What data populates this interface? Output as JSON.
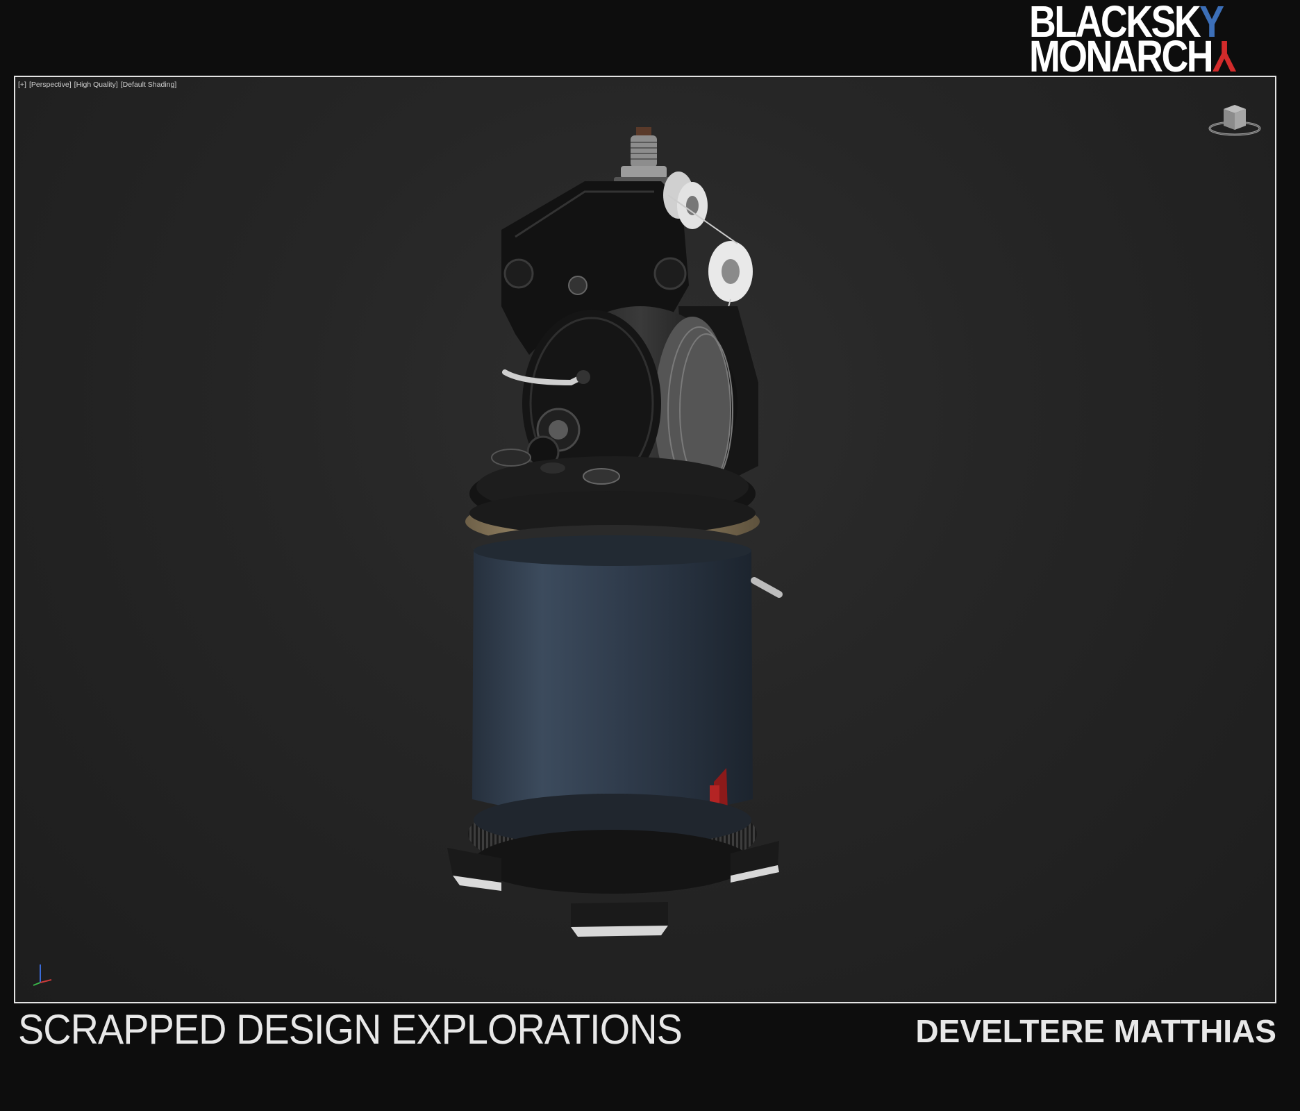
{
  "brand": {
    "line1_main": "BLACKSK",
    "line1_accent": "Y",
    "line2_main": "MONARCH",
    "line2_accent": "Y",
    "accent_blue": "#3c6fb8",
    "accent_red": "#d22b2b"
  },
  "viewport": {
    "label_plus": "[+]",
    "label_view": "[Perspective]",
    "label_quality": "[High Quality]",
    "label_shading": "[Default Shading]",
    "viewcube_icon": "viewcube-icon",
    "axis_icon": "axis-gizmo-icon"
  },
  "footer": {
    "title": "SCRAPPED DESIGN EXPLORATIONS",
    "author": "DEVELTERE MATTHIAS"
  }
}
